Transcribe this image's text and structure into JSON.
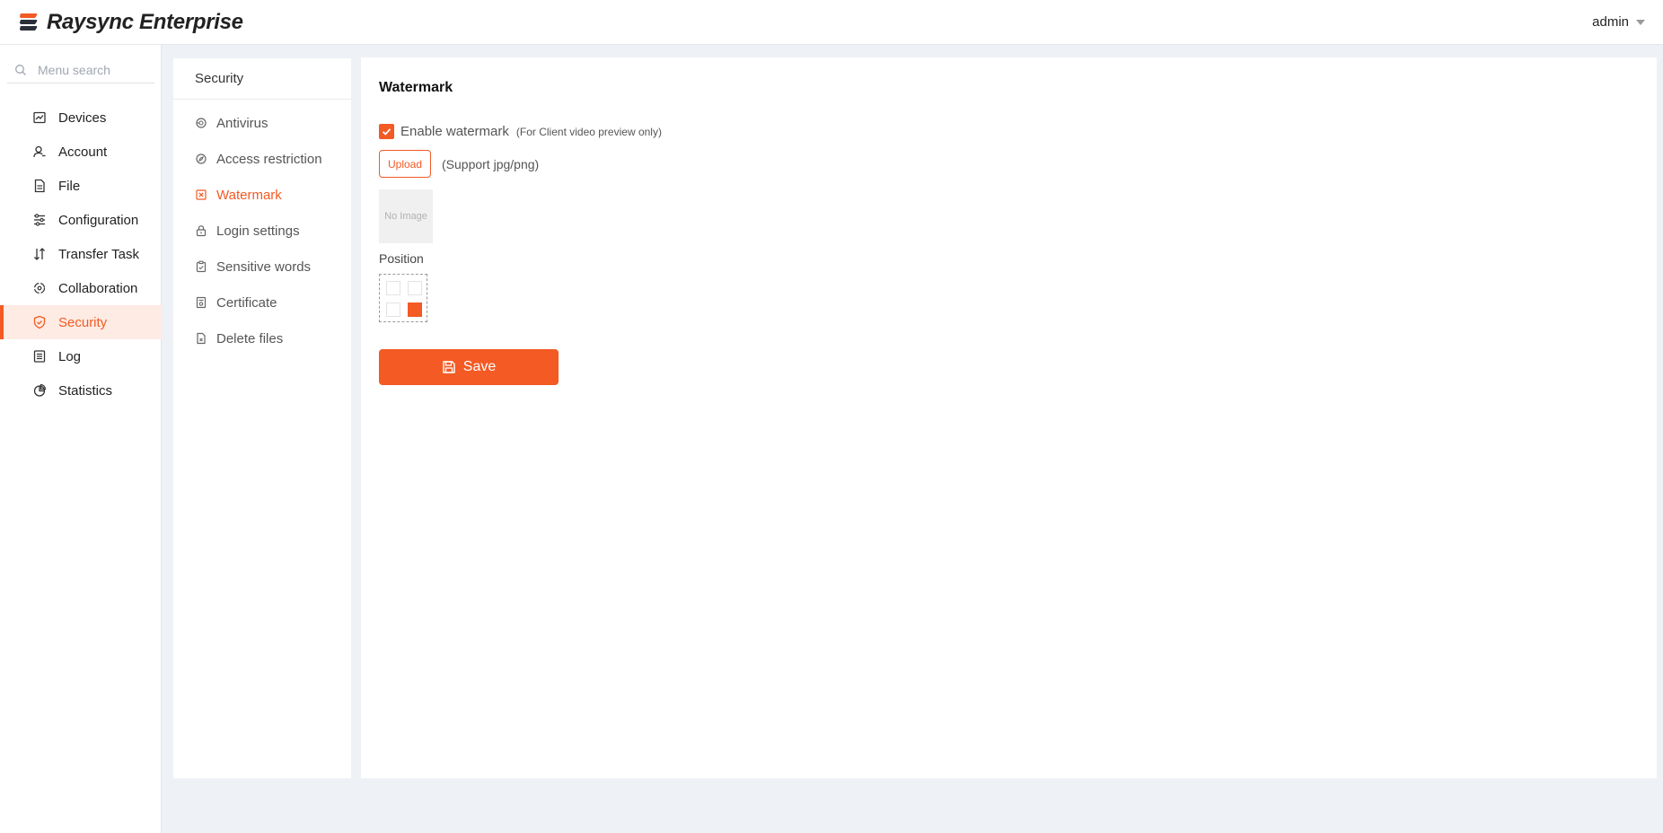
{
  "app": {
    "title": "Raysync Enterprise",
    "user": "admin"
  },
  "colors": {
    "accent": "#f35a24",
    "active_bg": "#fdebe4"
  },
  "search": {
    "placeholder": "Menu search",
    "icon": "search-icon"
  },
  "sidebar": {
    "items": [
      {
        "label": "Devices",
        "icon": "monitor-chart-icon"
      },
      {
        "label": "Account",
        "icon": "user-icon"
      },
      {
        "label": "File",
        "icon": "file-icon"
      },
      {
        "label": "Configuration",
        "icon": "sliders-icon"
      },
      {
        "label": "Transfer Task",
        "icon": "transfer-arrows-icon"
      },
      {
        "label": "Collaboration",
        "icon": "collaboration-icon"
      },
      {
        "label": "Security",
        "icon": "shield-icon",
        "active": true
      },
      {
        "label": "Log",
        "icon": "log-icon"
      },
      {
        "label": "Statistics",
        "icon": "pie-chart-icon"
      }
    ]
  },
  "subnav": {
    "title": "Security",
    "items": [
      {
        "label": "Antivirus",
        "icon": "antivirus-icon"
      },
      {
        "label": "Access restriction",
        "icon": "compass-icon"
      },
      {
        "label": "Watermark",
        "icon": "watermark-icon",
        "active": true
      },
      {
        "label": "Login settings",
        "icon": "lock-icon"
      },
      {
        "label": "Sensitive words",
        "icon": "clipboard-icon"
      },
      {
        "label": "Certificate",
        "icon": "certificate-icon"
      },
      {
        "label": "Delete files",
        "icon": "delete-file-icon"
      }
    ]
  },
  "watermark": {
    "title": "Watermark",
    "enable_label": "Enable watermark",
    "enable_note": "(For Client video preview only)",
    "enabled": true,
    "upload_label": "Upload",
    "upload_hint": "(Support jpg/png)",
    "no_image": "No Image",
    "position_label": "Position",
    "position_selected": "bottom-right",
    "save_label": "Save"
  }
}
